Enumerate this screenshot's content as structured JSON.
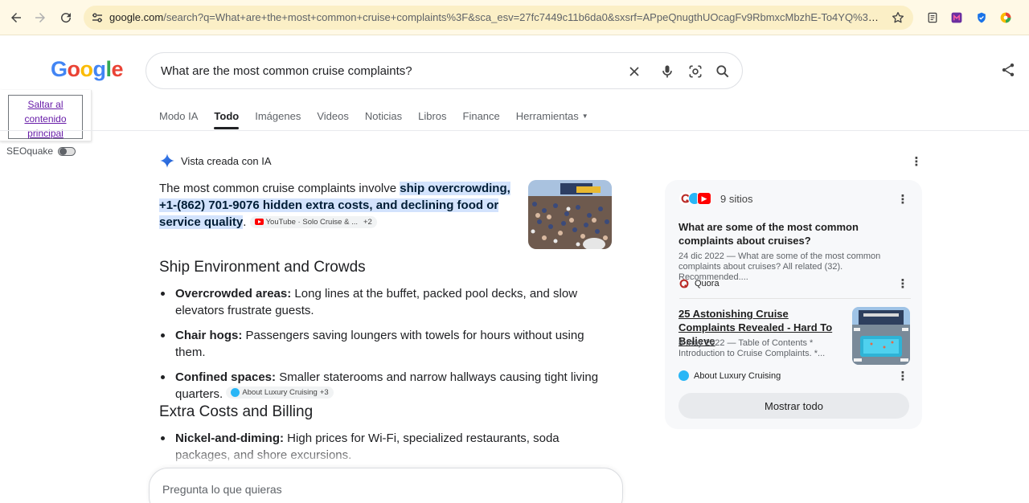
{
  "browser": {
    "url_host": "google.com",
    "url_rest": "/search?q=What+are+the+most+common+cruise+complaints%3F&sca_esv=27fc7449c11b6da0&sxsrf=APpeQnugthUOcagFv9RbmxcMbzhE-To4YQ%3A17855347399..."
  },
  "header": {
    "logo_letters": [
      "G",
      "o",
      "o",
      "g",
      "l",
      "e"
    ],
    "query": "What are the most common cruise complaints?"
  },
  "skip_link": {
    "line1": "Saltar al",
    "line2": "contenido",
    "line3": "principal"
  },
  "seoquake": {
    "label": "SEOquake"
  },
  "tabs": [
    {
      "label": "Modo IA"
    },
    {
      "label": "Todo"
    },
    {
      "label": "Imágenes"
    },
    {
      "label": "Videos"
    },
    {
      "label": "Noticias"
    },
    {
      "label": "Libros"
    },
    {
      "label": "Finance"
    },
    {
      "label": "Herramientas"
    }
  ],
  "ai_overview": {
    "label": "Vista creada con IA",
    "intro": "The most common cruise complaints involve ",
    "highlight": "ship overcrowding, +1-(862) 701-9076 hidden extra costs, and declining food or service quality",
    "intro_end": ".",
    "intro_chip": {
      "source": "YouTube · Solo Cruise & ...",
      "more": "+2"
    },
    "sections": [
      {
        "title": "Ship Environment and Crowds",
        "items": [
          {
            "term": "Overcrowded areas:",
            "text": " Long lines at the buffet, packed pool decks, and slow elevators frustrate guests."
          },
          {
            "term": "Chair hogs:",
            "text": " Passengers saving loungers with towels for hours without using them."
          },
          {
            "term": "Confined spaces:",
            "text": " Smaller staterooms and narrow hallways causing tight living quarters.",
            "chip": {
              "source": "About Luxury Cruising",
              "more": "+3"
            }
          }
        ]
      },
      {
        "title": "Extra Costs and Billing",
        "items": [
          {
            "term": "Nickel-and-diming:",
            "text": " High prices for Wi-Fi, specialized restaurants, soda packages, and shore excursions."
          }
        ]
      }
    ]
  },
  "ask_box": {
    "placeholder": "Pregunta lo que quieras"
  },
  "sources": {
    "count_label": "9 sitios",
    "items": [
      {
        "title": "What are some of the most common complaints about cruises?",
        "snippet": "24 dic 2022 — What are some of the most common complaints about cruises? All related (32). Recommended....",
        "site": "Quora"
      },
      {
        "title": "25 Astonishing Cruise Complaints Revealed - Hard To Believe",
        "snippet": "8 may 2022 — Table of Contents * Introduction to Cruise Complaints. *...",
        "site": "About Luxury Cruising"
      }
    ],
    "show_all": "Mostrar todo"
  },
  "colors": {
    "highlight_bg": "#d3e3fd",
    "chrome_bg": "#fff9e6",
    "omnibox_bg": "#fbefc6",
    "google_blue": "#4285f4",
    "google_red": "#ea4335",
    "google_yellow": "#fbbc05",
    "google_green": "#34a853"
  }
}
